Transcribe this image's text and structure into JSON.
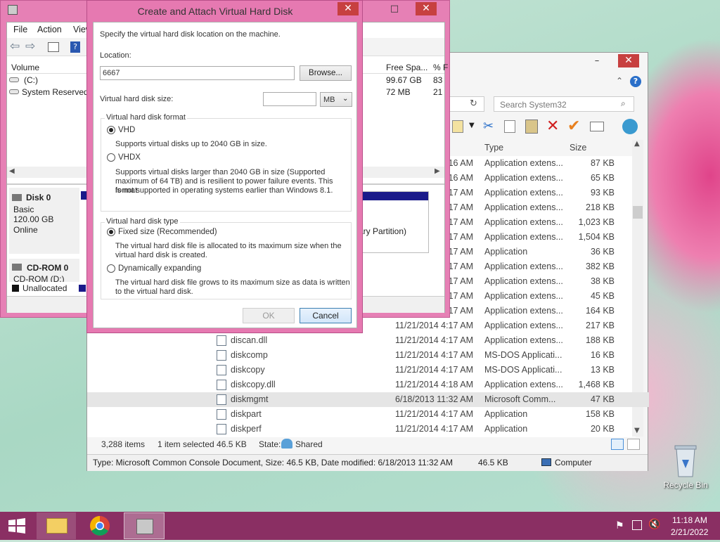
{
  "desktop": {
    "recycle_bin": "Recycle Bin"
  },
  "disk_management": {
    "menu": [
      "File",
      "Action",
      "View"
    ],
    "columns": {
      "volume": "Volume",
      "free_space": "Free Spa...",
      "percent": "% F"
    },
    "volumes": [
      {
        "name": "(C:)",
        "free": "99.67 GB",
        "pct": "83"
      },
      {
        "name": "System Reserved",
        "free": "72 MB",
        "pct": "21"
      }
    ],
    "disk0": {
      "name": "Disk 0",
      "type": "Basic",
      "size": "120.00 GB",
      "status": "Online",
      "partition": "ary Partition)"
    },
    "cdrom": {
      "name": "CD-ROM 0",
      "drive": "CD-ROM (D:)"
    },
    "legend": {
      "unallocated": "Unallocated",
      "primary": "P"
    }
  },
  "dialog": {
    "title": "Create and Attach Virtual Hard Disk",
    "intro": "Specify the virtual hard disk location on the machine.",
    "location_label": "Location:",
    "location_value": "6667",
    "browse_button": "Browse...",
    "size_label": "Virtual hard disk size:",
    "size_value": "",
    "size_unit": "MB",
    "format_group": "Virtual hard disk format",
    "vhd_label": "VHD",
    "vhd_desc": "Supports virtual disks up to 2040 GB in size.",
    "vhdx_label": "VHDX",
    "vhdx_desc1": "Supports virtual disks larger than 2040 GB in size (Supported",
    "vhdx_desc2": "maximum of 64 TB) and is resilient to power failure events. This format",
    "vhdx_desc3": "is not supported in operating systems earlier than Windows 8.1.",
    "type_group": "Virtual hard disk type",
    "fixed_label": "Fixed size (Recommended)",
    "fixed_desc1": "The virtual hard disk file is allocated to its maximum size when the",
    "fixed_desc2": "virtual hard disk is created.",
    "dynamic_label": "Dynamically expanding",
    "dynamic_desc1": "The virtual hard disk file grows to its maximum size as data is written",
    "dynamic_desc2": "to the virtual hard disk.",
    "ok_button": "OK",
    "cancel_button": "Cancel",
    "format_selected": "VHD",
    "type_selected": "Fixed size (Recommended)"
  },
  "explorer": {
    "search_placeholder": "Search System32",
    "columns": {
      "type": "Type",
      "size": "Size"
    },
    "rows": [
      {
        "name": "",
        "date": "16 AM",
        "type": "Application extens...",
        "size": "87 KB"
      },
      {
        "name": "",
        "date": "16 AM",
        "type": "Application extens...",
        "size": "65 KB"
      },
      {
        "name": "",
        "date": "17 AM",
        "type": "Application extens...",
        "size": "93 KB"
      },
      {
        "name": "",
        "date": "17 AM",
        "type": "Application extens...",
        "size": "218 KB"
      },
      {
        "name": "",
        "date": "17 AM",
        "type": "Application extens...",
        "size": "1,023 KB"
      },
      {
        "name": "",
        "date": "17 AM",
        "type": "Application extens...",
        "size": "1,504 KB"
      },
      {
        "name": "",
        "date": "17 AM",
        "type": "Application",
        "size": "36 KB"
      },
      {
        "name": "",
        "date": "17 AM",
        "type": "Application extens...",
        "size": "382 KB"
      },
      {
        "name": "",
        "date": "17 AM",
        "type": "Application extens...",
        "size": "38 KB"
      },
      {
        "name": "",
        "date": "17 AM",
        "type": "Application extens...",
        "size": "45 KB"
      },
      {
        "name": "",
        "date": "17 AM",
        "type": "Application extens...",
        "size": "164 KB"
      },
      {
        "name": "",
        "date": "11/21/2014 4:17 AM",
        "type": "Application extens...",
        "size": "217 KB"
      },
      {
        "name": "discan.dll",
        "date": "11/21/2014 4:17 AM",
        "type": "Application extens...",
        "size": "188 KB"
      },
      {
        "name": "diskcomp",
        "date": "11/21/2014 4:17 AM",
        "type": "MS-DOS Applicati...",
        "size": "16 KB"
      },
      {
        "name": "diskcopy",
        "date": "11/21/2014 4:17 AM",
        "type": "MS-DOS Applicati...",
        "size": "13 KB"
      },
      {
        "name": "diskcopy.dll",
        "date": "11/21/2014 4:18 AM",
        "type": "Application extens...",
        "size": "1,468 KB"
      },
      {
        "name": "diskmgmt",
        "date": "6/18/2013 11:32 AM",
        "type": "Microsoft Comm...",
        "size": "47 KB"
      },
      {
        "name": "diskpart",
        "date": "11/21/2014 4:17 AM",
        "type": "Application",
        "size": "158 KB"
      },
      {
        "name": "diskperf",
        "date": "11/21/2014 4:17 AM",
        "type": "Application",
        "size": "20 KB"
      }
    ],
    "selected_row": "diskmgmt",
    "status": {
      "items": "3,288 items",
      "selected": "1 item selected  46.5 KB",
      "state_label": "State:",
      "state_value": "Shared"
    },
    "details": {
      "text": "Type: Microsoft Common Console Document, Size: 46.5 KB, Date modified: 6/18/2013 11:32 AM",
      "size": "46.5 KB",
      "location": "Computer"
    }
  },
  "taskbar": {
    "time": "11:18 AM",
    "date": "2/21/2022"
  }
}
